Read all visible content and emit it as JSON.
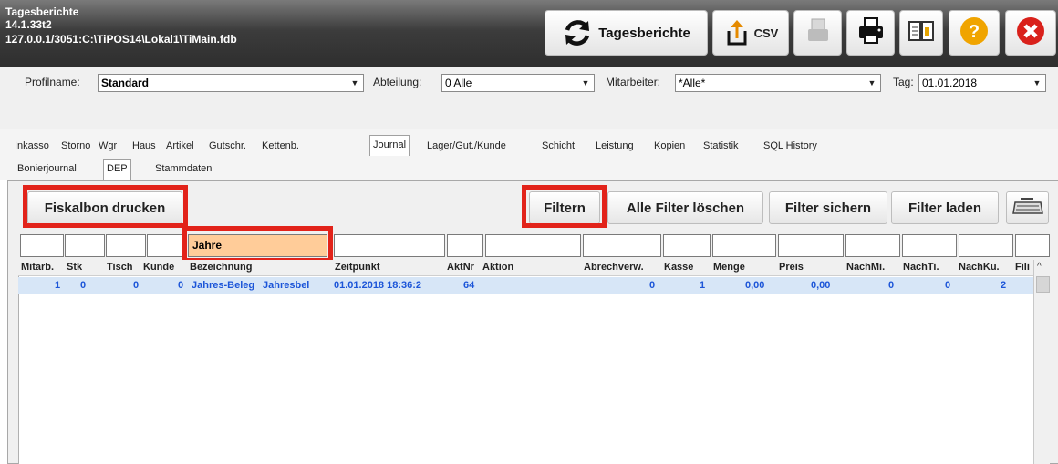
{
  "window": {
    "title": "Tagesberichte",
    "version": "14.1.33t2",
    "db_path": "127.0.0.1/3051:C:\\TiPOS14\\Lokal1\\TiMain.fdb"
  },
  "toolbar": {
    "tagesberichte_label": "Tagesberichte",
    "csv_label": "CSV"
  },
  "filters": {
    "profilname_label": "Profilname:",
    "profilname_value": "Standard",
    "abteilung_label": "Abteilung:",
    "abteilung_value": "0 Alle",
    "mitarbeiter_label": "Mitarbeiter:",
    "mitarbeiter_value": "*Alle*",
    "tag_label": "Tag:",
    "tag_value": "01.01.2018"
  },
  "tabs": [
    "Inkasso",
    "Storno",
    "Wgr",
    "Haus",
    "Artikel",
    "Gutschr.",
    "Kettenb.",
    "Journal",
    "Lager/Gut./Kunde",
    "Schicht",
    "Leistung",
    "Kopien",
    "Statistik",
    "SQL History"
  ],
  "active_tab": "Journal",
  "subtabs": [
    "Bonierjournal",
    "DEP",
    "Stammdaten"
  ],
  "active_subtab": "DEP",
  "buttons": {
    "fiskalbon": "Fiskalbon drucken",
    "filtern": "Filtern",
    "alle_filter_loeschen": "Alle Filter löschen",
    "filter_sichern": "Filter sichern",
    "filter_laden": "Filter laden"
  },
  "filter_row": {
    "bezeichnung_value": "Jahre"
  },
  "grid": {
    "columns": [
      "Mitarb.",
      "Stk",
      "Tisch",
      "Kunde",
      "Bezeichnung",
      "Zeitpunkt",
      "AktNr",
      "Aktion",
      "Abrechverw.",
      "Kasse",
      "Menge",
      "Preis",
      "NachMi.",
      "NachTi.",
      "NachKu.",
      "Fili"
    ],
    "rows": [
      [
        "1",
        "0",
        "0",
        "0",
        "Jahres-Beleg",
        "Jahresbel",
        "01.01.2018 18:36:2",
        "64",
        "",
        "0",
        "1",
        "0,00",
        "0,00",
        "0",
        "0",
        "2"
      ]
    ]
  },
  "colors": {
    "highlight_red": "#e2231a",
    "row_text": "#1c55d8",
    "selected_row": "#d7e6f7",
    "filter_active_bg": "#ffcc99"
  }
}
